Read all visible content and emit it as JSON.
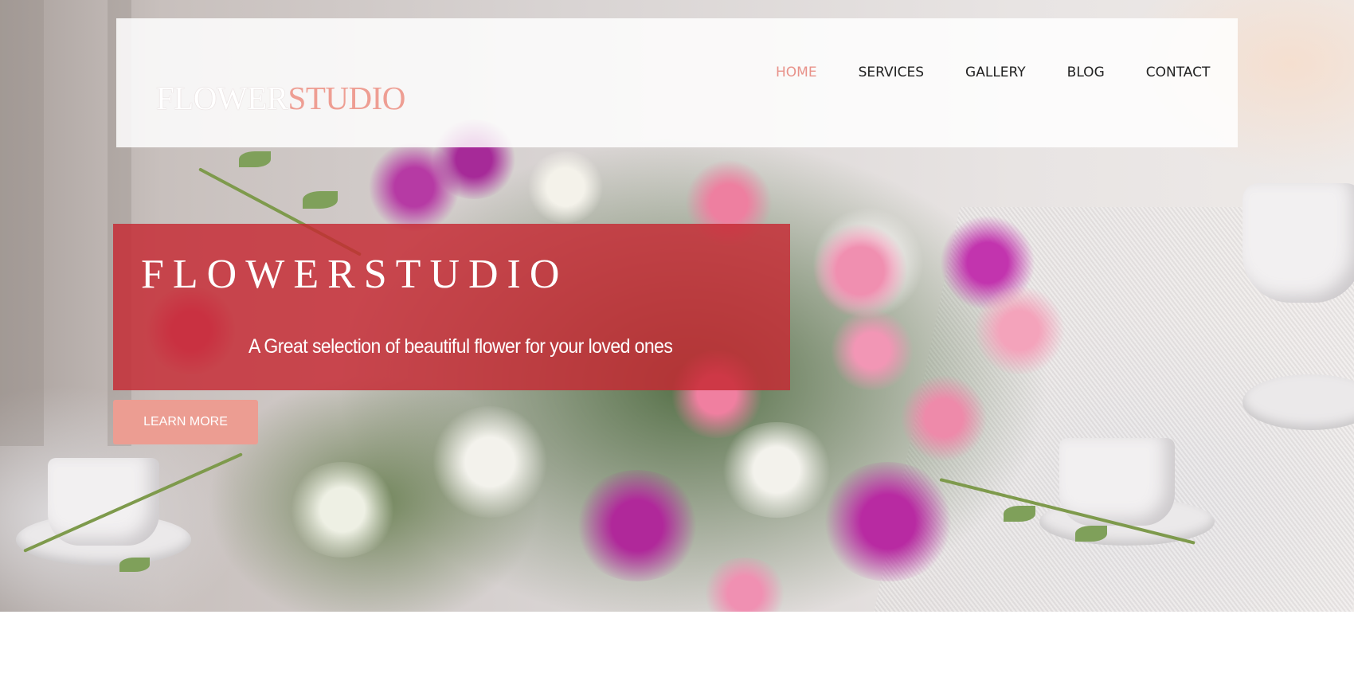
{
  "header": {
    "logo_part1": "FLOWER",
    "logo_part2": "STUDIO",
    "nav": [
      {
        "label": "HOME",
        "active": true
      },
      {
        "label": "SERVICES",
        "active": false
      },
      {
        "label": "GALLERY",
        "active": false
      },
      {
        "label": "BLOG",
        "active": false
      },
      {
        "label": "CONTACT",
        "active": false
      }
    ]
  },
  "hero": {
    "title": "FLOWERSTUDIO",
    "subtitle": "A Great selection of beautiful flower for your loved ones",
    "cta_label": "LEARN MORE",
    "image_subject": "flower-bouquet-photo"
  },
  "colors": {
    "accent": "#ec9d92",
    "nav_active": "#e8928a",
    "banner": "#c62832",
    "header_bg": "#ffffff"
  }
}
